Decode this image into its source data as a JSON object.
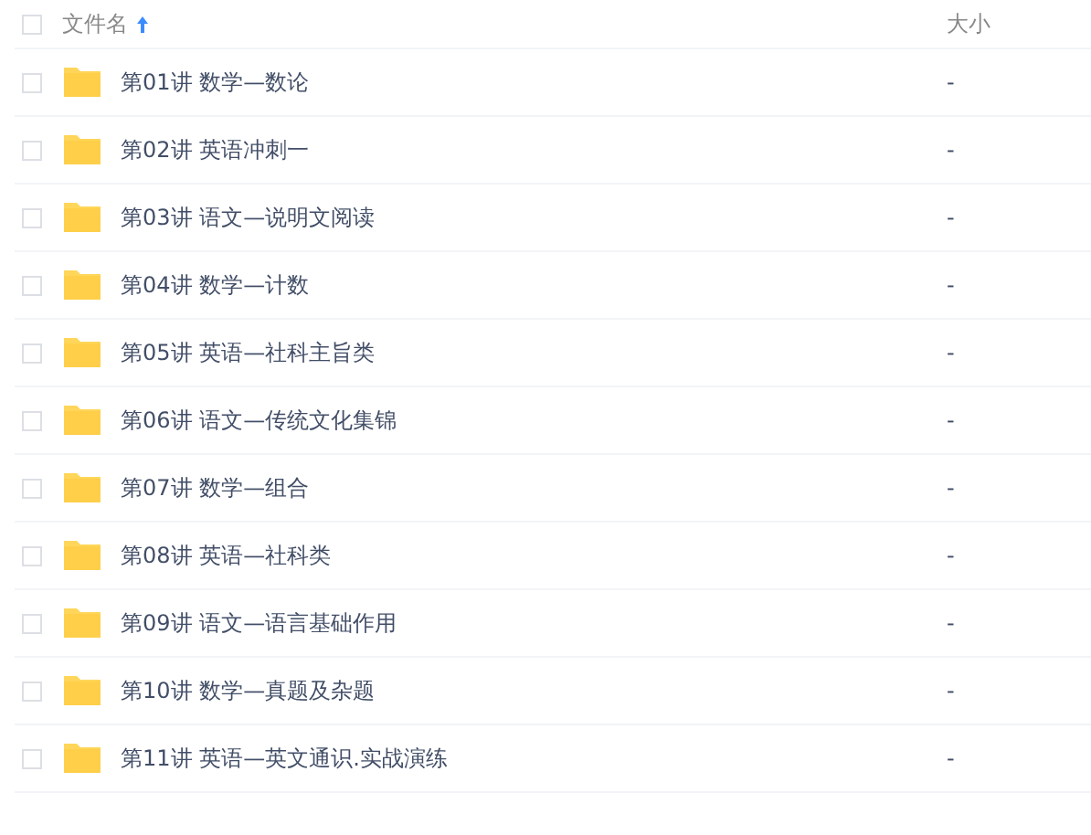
{
  "header": {
    "name_label": "文件名",
    "sort_ascending": true,
    "size_label": "大小",
    "checked": false
  },
  "rows": [
    {
      "name": "第01讲 数学—数论",
      "size": "-",
      "checked": false
    },
    {
      "name": "第02讲 英语冲刺一",
      "size": "-",
      "checked": false
    },
    {
      "name": "第03讲 语文—说明文阅读",
      "size": "-",
      "checked": false
    },
    {
      "name": "第04讲 数学—计数",
      "size": "-",
      "checked": false
    },
    {
      "name": "第05讲 英语—社科主旨类",
      "size": "-",
      "checked": false
    },
    {
      "name": "第06讲 语文—传统文化集锦",
      "size": "-",
      "checked": false
    },
    {
      "name": "第07讲 数学—组合",
      "size": "-",
      "checked": false
    },
    {
      "name": "第08讲 英语—社科类",
      "size": "-",
      "checked": false
    },
    {
      "name": "第09讲 语文—语言基础作用",
      "size": "-",
      "checked": false
    },
    {
      "name": "第10讲 数学—真题及杂题",
      "size": "-",
      "checked": false
    },
    {
      "name": "第11讲 英语—英文通识.实战演练",
      "size": "-",
      "checked": false
    }
  ]
}
